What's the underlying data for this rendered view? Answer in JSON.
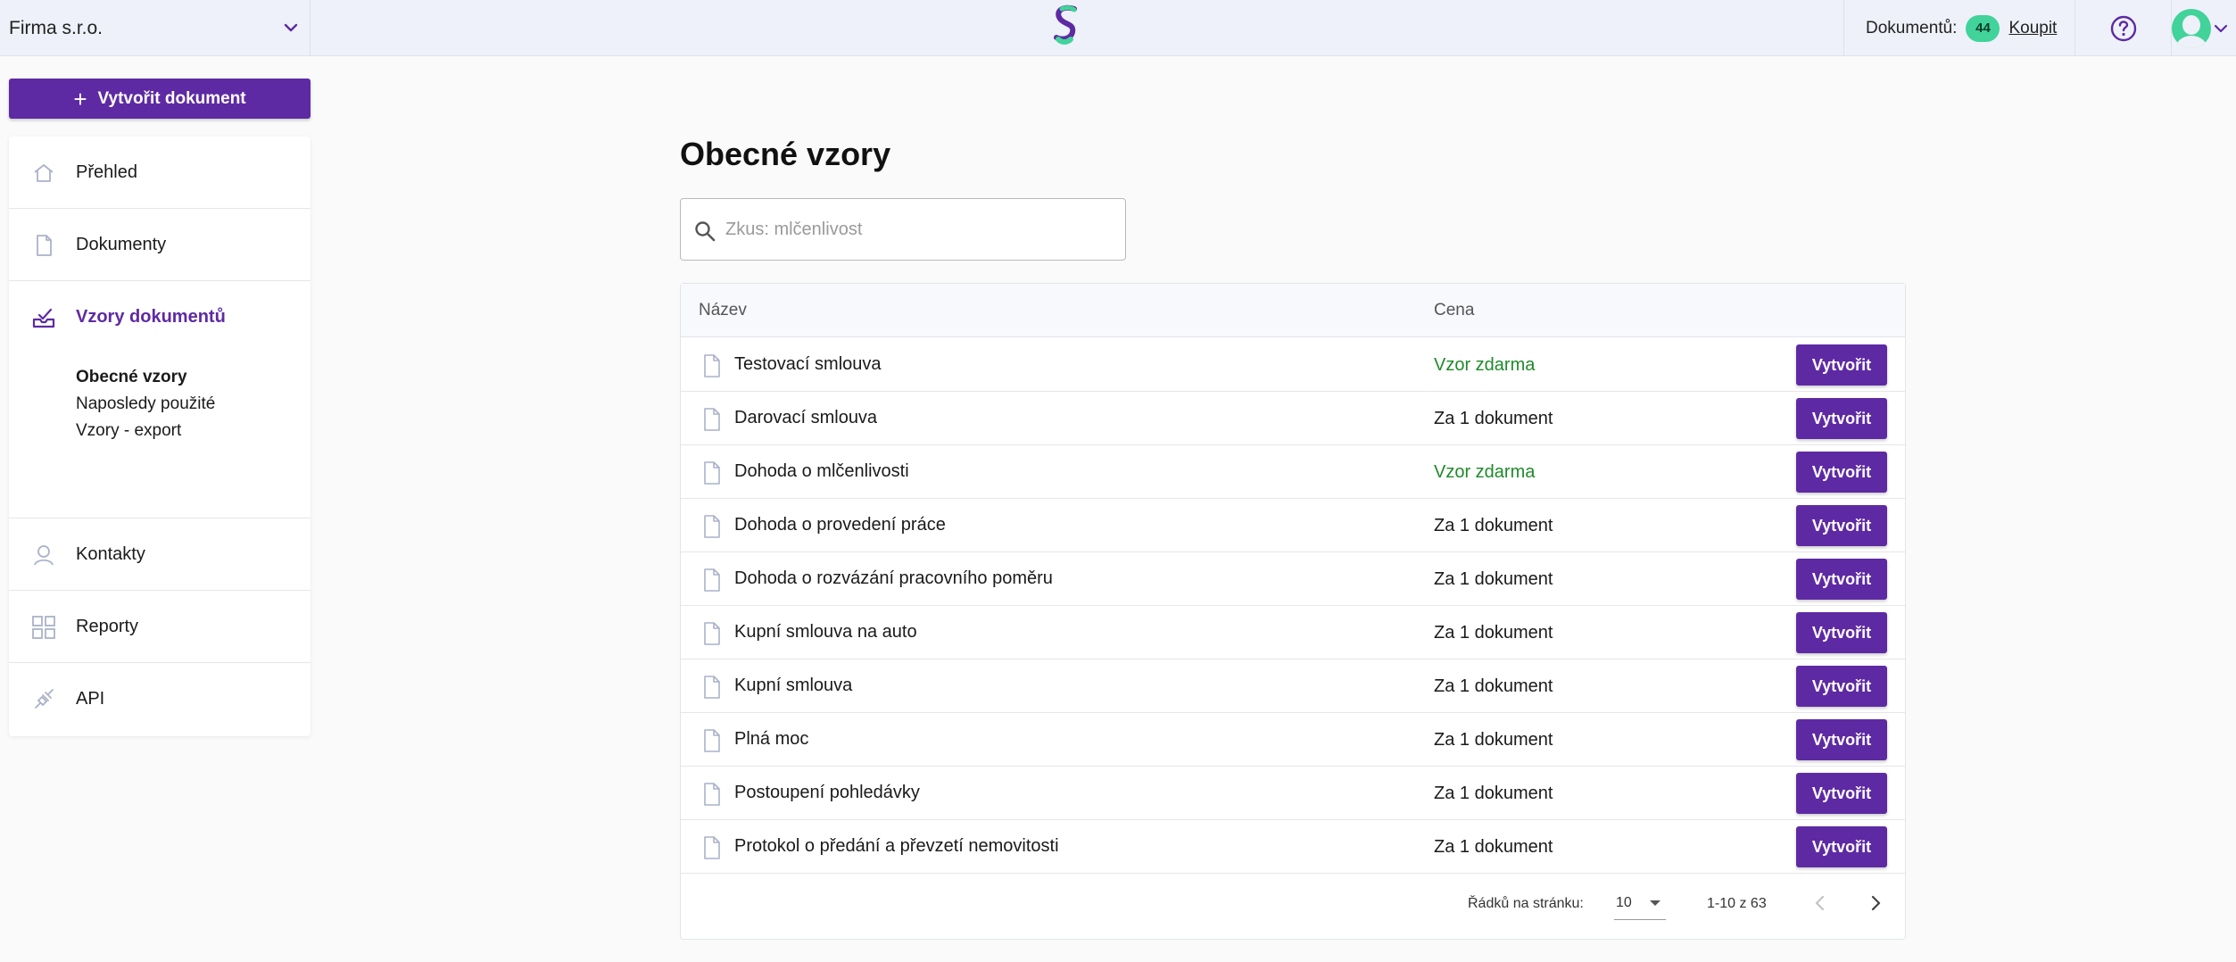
{
  "topbar": {
    "company": "Firma s.r.o.",
    "documents_label": "Dokumentů:",
    "documents_count": "44",
    "buy_label": "Koupit",
    "brand_color": "#5e2aa3",
    "accent_green": "#41d39a"
  },
  "sidebar": {
    "create_button": "Vytvořit dokument",
    "items": [
      {
        "label": "Přehled",
        "icon": "home-icon"
      },
      {
        "label": "Dokumenty",
        "icon": "document-icon"
      },
      {
        "label": "Vzory dokumentů",
        "icon": "template-inbox-icon"
      },
      {
        "label": "Kontakty",
        "icon": "contact-icon"
      },
      {
        "label": "Reporty",
        "icon": "grid-report-icon"
      },
      {
        "label": "API",
        "icon": "plug-icon"
      }
    ],
    "subitems": [
      {
        "label": "Obecné vzory"
      },
      {
        "label": "Naposledy použité"
      },
      {
        "label": "Vzory - export"
      }
    ]
  },
  "main": {
    "title": "Obecné vzory",
    "search_placeholder": "Zkus: mlčenlivost",
    "columns": {
      "name": "Název",
      "price": "Cena"
    },
    "rows": [
      {
        "name": "Testovací smlouva",
        "price": "Vzor zdarma",
        "free": true,
        "action": "Vytvořit"
      },
      {
        "name": "Darovací smlouva",
        "price": "Za 1 dokument",
        "free": false,
        "action": "Vytvořit"
      },
      {
        "name": "Dohoda o mlčenlivosti",
        "price": "Vzor zdarma",
        "free": true,
        "action": "Vytvořit"
      },
      {
        "name": "Dohoda o provedení práce",
        "price": "Za 1 dokument",
        "free": false,
        "action": "Vytvořit"
      },
      {
        "name": "Dohoda o rozvázání pracovního poměru",
        "price": "Za 1 dokument",
        "free": false,
        "action": "Vytvořit"
      },
      {
        "name": "Kupní smlouva na auto",
        "price": "Za 1 dokument",
        "free": false,
        "action": "Vytvořit"
      },
      {
        "name": "Kupní smlouva",
        "price": "Za 1 dokument",
        "free": false,
        "action": "Vytvořit"
      },
      {
        "name": "Plná moc",
        "price": "Za 1 dokument",
        "free": false,
        "action": "Vytvořit"
      },
      {
        "name": "Postoupení pohledávky",
        "price": "Za 1 dokument",
        "free": false,
        "action": "Vytvořit"
      },
      {
        "name": "Protokol o předání a převzetí nemovitosti",
        "price": "Za 1 dokument",
        "free": false,
        "action": "Vytvořit"
      }
    ],
    "pagination": {
      "rows_per_page_label": "Řádků na stránku:",
      "rows_per_page": "10",
      "range": "1-10 z 63"
    }
  }
}
